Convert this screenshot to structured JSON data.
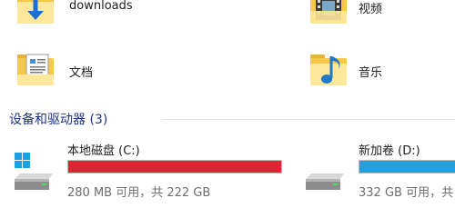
{
  "folders": [
    {
      "label": "downloads",
      "icon": "downloads-folder-icon"
    },
    {
      "label": "视频",
      "icon": "videos-folder-icon"
    },
    {
      "label": "文档",
      "icon": "documents-folder-icon"
    },
    {
      "label": "音乐",
      "icon": "music-folder-icon"
    }
  ],
  "devices_section": {
    "title": "设备和驱动器 (3)"
  },
  "drives": [
    {
      "name": "本地磁盘 (C:)",
      "free_text": "280 MB 可用，共 222 GB",
      "used_fraction": 0.999,
      "bar_color": "#da2632",
      "icon": "windows-system-drive-icon"
    },
    {
      "name": "新加卷 (D:)",
      "free_text": "332 GB 可用，共",
      "used_fraction": 0.9,
      "bar_color": "#26a0da",
      "icon": "hard-drive-icon"
    }
  ],
  "colors": {
    "folder_yellow": "#f5c84c",
    "folder_light": "#fde79a",
    "section_title_blue": "#1e3287",
    "drive_full_red": "#da2632",
    "drive_normal_blue": "#26a0da"
  }
}
